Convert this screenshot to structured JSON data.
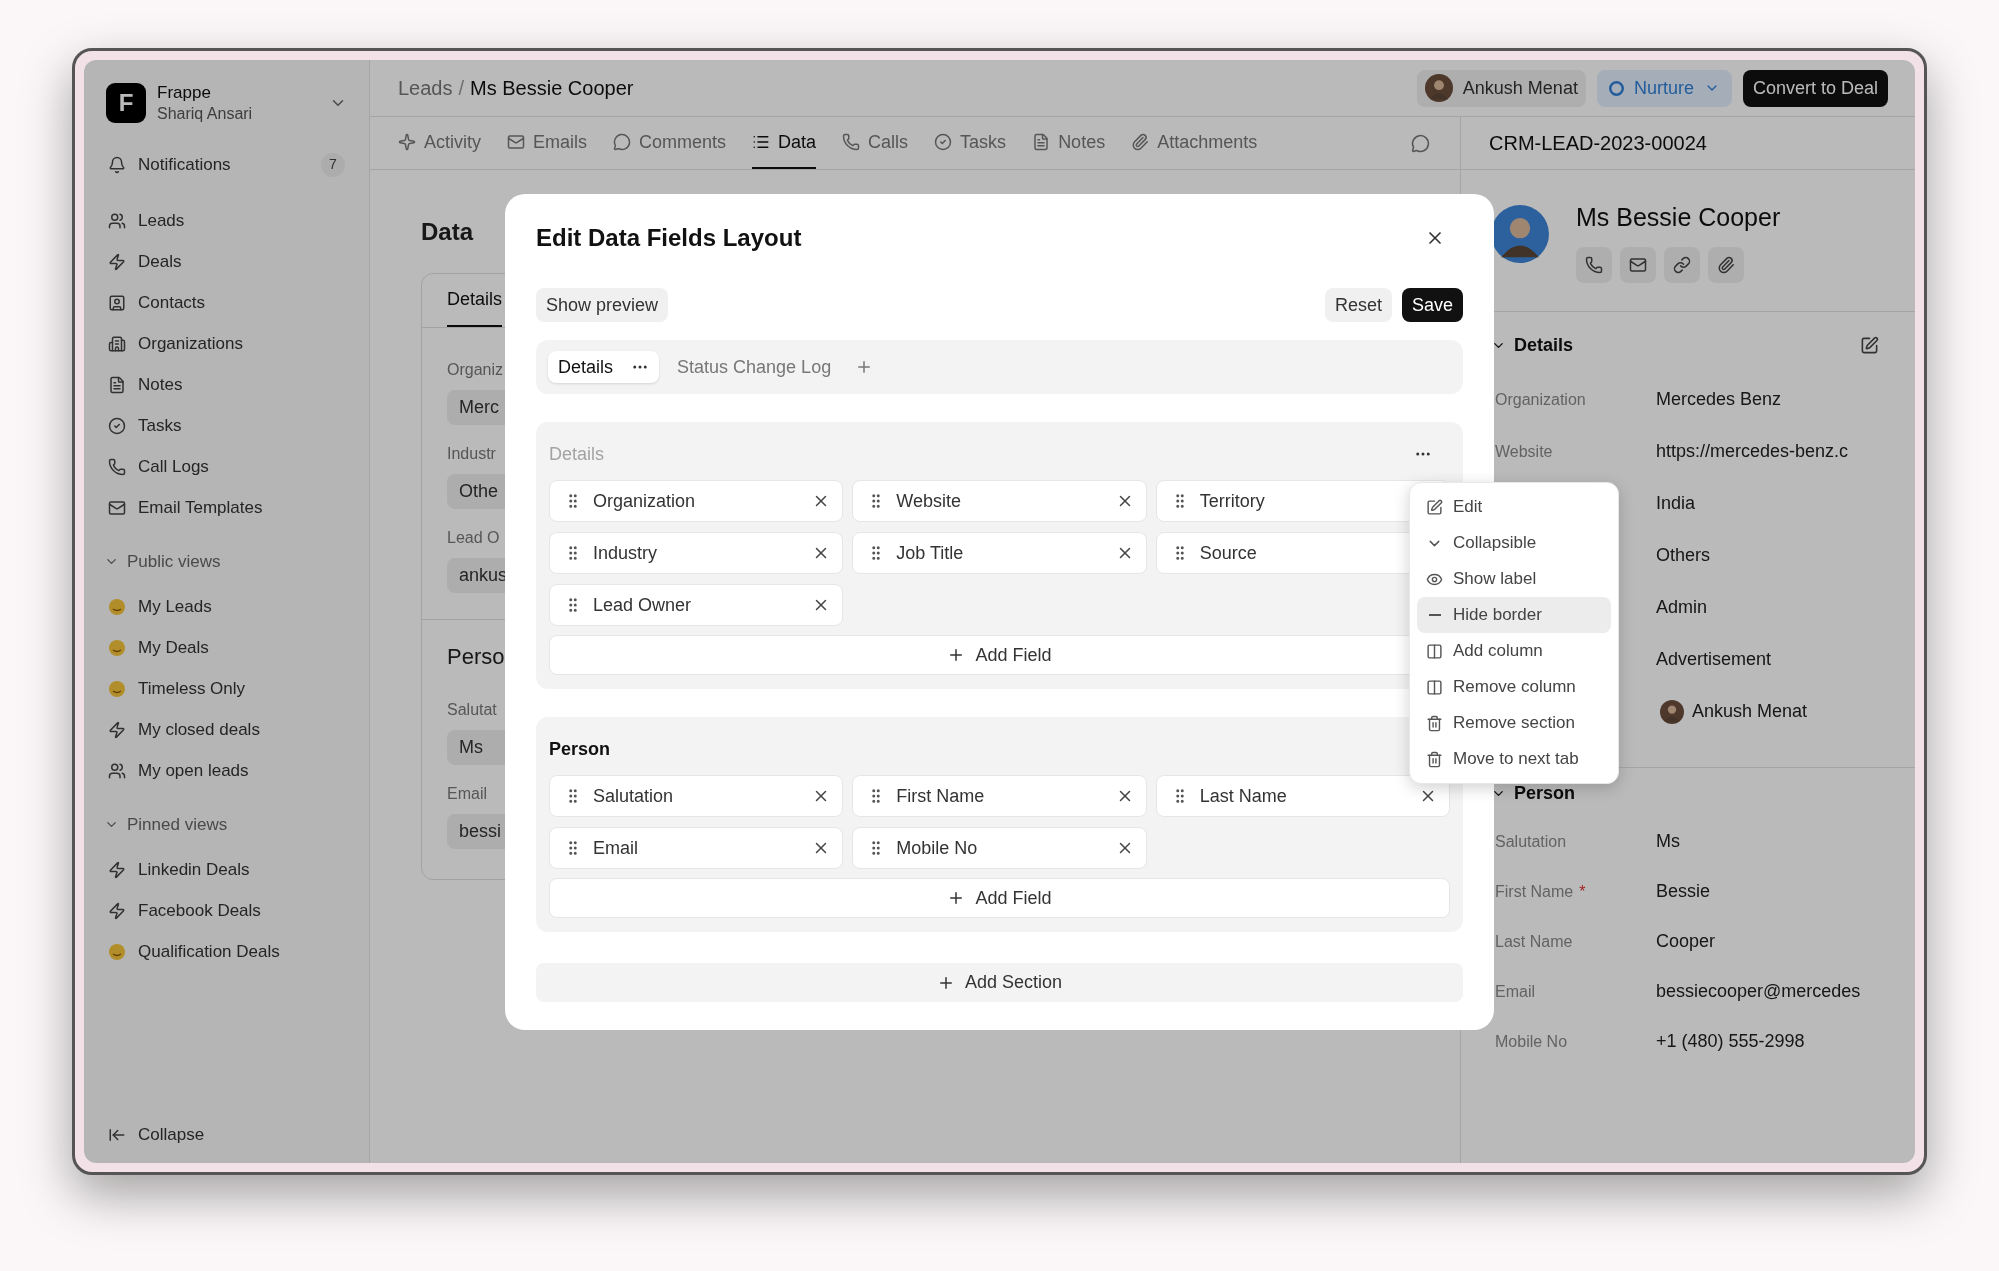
{
  "sidebar": {
    "workspace": {
      "logo": "F",
      "name": "Frappe",
      "user": "Shariq Ansari"
    },
    "notifications": {
      "label": "Notifications",
      "count": "7"
    },
    "nav": [
      {
        "label": "Leads"
      },
      {
        "label": "Deals"
      },
      {
        "label": "Contacts"
      },
      {
        "label": "Organizations"
      },
      {
        "label": "Notes"
      },
      {
        "label": "Tasks"
      },
      {
        "label": "Call Logs"
      },
      {
        "label": "Email Templates"
      }
    ],
    "view_groups": [
      {
        "label": "Public views",
        "expanded": true,
        "items": [
          {
            "label": "My Leads"
          },
          {
            "label": "My Deals"
          },
          {
            "label": "Timeless Only"
          },
          {
            "label": "My closed deals"
          },
          {
            "label": "My open leads"
          }
        ]
      },
      {
        "label": "Pinned views",
        "expanded": true,
        "items": [
          {
            "label": "Linkedin Deals"
          },
          {
            "label": "Facebook Deals"
          },
          {
            "label": "Qualification Deals"
          }
        ]
      }
    ],
    "collapse": "Collapse"
  },
  "header": {
    "breadcrumb": {
      "parent": "Leads",
      "separator": "/",
      "current": "Ms Bessie Cooper"
    },
    "assignee": "Ankush Menat",
    "status": "Nurture",
    "action": "Convert to Deal"
  },
  "tabs": [
    {
      "label": "Activity",
      "selected": false
    },
    {
      "label": "Emails",
      "selected": false
    },
    {
      "label": "Comments",
      "selected": false
    },
    {
      "label": "Data",
      "selected": true
    },
    {
      "label": "Calls",
      "selected": false
    },
    {
      "label": "Tasks",
      "selected": false
    },
    {
      "label": "Notes",
      "selected": false
    },
    {
      "label": "Attachments",
      "selected": false
    }
  ],
  "page": {
    "title": "Data",
    "tab": "Details",
    "fields": [
      {
        "label": "Organiz",
        "value": "Merc"
      },
      {
        "label": "Industr",
        "value": "Othe"
      },
      {
        "label": "Lead O",
        "value": "ankus"
      }
    ],
    "person": {
      "title": "Perso",
      "fields": [
        {
          "label": "Salutat",
          "value": "Ms"
        },
        {
          "label": "Email",
          "value": "bessi"
        }
      ]
    }
  },
  "record": {
    "id": "CRM-LEAD-2023-00024",
    "name": "Ms Bessie Cooper",
    "sections": [
      {
        "title": "Details",
        "expanded": true,
        "editable": true,
        "rows": [
          {
            "label": "Organization",
            "value": "Mercedes Benz",
            "kind": "text"
          },
          {
            "label": "Website",
            "value": "https://mercedes-benz.c",
            "kind": "text"
          },
          {
            "value": "India",
            "kind": "text"
          },
          {
            "value": "Others",
            "kind": "text"
          },
          {
            "value": "Admin",
            "kind": "text"
          },
          {
            "value": "Advertisement",
            "kind": "text"
          },
          {
            "value": "Ankush Menat",
            "kind": "user"
          }
        ]
      },
      {
        "title": "Person",
        "expanded": true,
        "editable": false,
        "rows": [
          {
            "label": "Salutation",
            "value": "Ms",
            "kind": "text"
          },
          {
            "label": "First Name",
            "required_mark": "*",
            "value": "Bessie",
            "kind": "text"
          },
          {
            "label": "Last Name",
            "value": "Cooper",
            "kind": "text"
          },
          {
            "label": "Email",
            "value": "bessiecooper@mercedes",
            "kind": "text"
          },
          {
            "label": "Mobile No",
            "value": "+1 (480) 555-2998",
            "kind": "text"
          }
        ]
      }
    ]
  },
  "modal": {
    "title": "Edit Data Fields Layout",
    "preview": "Show preview",
    "reset": "Reset",
    "save": "Save",
    "layout_tabs": [
      {
        "label": "Details",
        "selected": true
      },
      {
        "label": "Status Change Log",
        "selected": false
      }
    ],
    "sections": [
      {
        "title": "Details",
        "label_hidden": true,
        "add_field": "Add Field",
        "fields": [
          {
            "label": "Organization"
          },
          {
            "label": "Website"
          },
          {
            "label": "Territory"
          },
          {
            "label": "Industry"
          },
          {
            "label": "Job Title"
          },
          {
            "label": "Source"
          },
          {
            "label": "Lead Owner"
          }
        ]
      },
      {
        "title": "Person",
        "label_hidden": false,
        "add_field": "Add Field",
        "fields": [
          {
            "label": "Salutation"
          },
          {
            "label": "First Name"
          },
          {
            "label": "Last Name"
          },
          {
            "label": "Email"
          },
          {
            "label": "Mobile No"
          }
        ]
      }
    ],
    "add_section": "Add Section"
  },
  "menu": {
    "items": [
      {
        "label": "Edit",
        "highlighted": false
      },
      {
        "label": "Collapsible",
        "highlighted": false
      },
      {
        "label": "Show label",
        "highlighted": false
      },
      {
        "label": "Hide border",
        "highlighted": true
      },
      {
        "label": "Add column",
        "highlighted": false
      },
      {
        "label": "Remove column",
        "highlighted": false
      },
      {
        "label": "Remove section",
        "highlighted": false
      },
      {
        "label": "Move to next tab",
        "highlighted": false
      }
    ]
  }
}
